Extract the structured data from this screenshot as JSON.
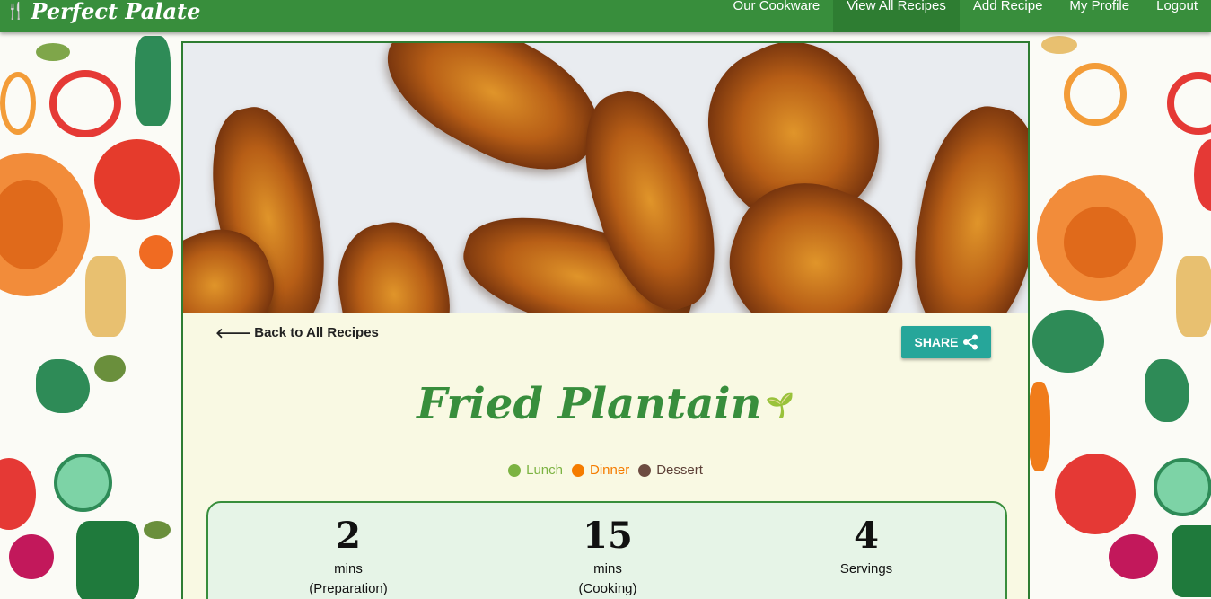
{
  "brand": {
    "name": "Perfect Palate",
    "icon": "fork-icon"
  },
  "nav": {
    "items": [
      {
        "label": "Our Cookware",
        "active": false
      },
      {
        "label": "View All Recipes",
        "active": true
      },
      {
        "label": "Add Recipe",
        "active": false
      },
      {
        "label": "My Profile",
        "active": false
      },
      {
        "label": "Logout",
        "active": false
      }
    ]
  },
  "recipe": {
    "back_label": "Back to All Recipes",
    "share_label": "SHARE",
    "title": "Fried Plantain",
    "tags": [
      {
        "label": "Lunch",
        "color": "#7cb342"
      },
      {
        "label": "Dinner",
        "color": "#f57c00"
      },
      {
        "label": "Dessert",
        "color": "#6d4c41"
      }
    ],
    "stats": {
      "prep": {
        "value": "2",
        "unit": "mins",
        "sub": "(Preparation)"
      },
      "cook": {
        "value": "15",
        "unit": "mins",
        "sub": "(Cooking)"
      },
      "servings": {
        "value": "4",
        "unit": "Servings"
      }
    }
  },
  "colors": {
    "nav": "#388e3c",
    "accent": "#26a69a",
    "title": "#388e3c"
  }
}
